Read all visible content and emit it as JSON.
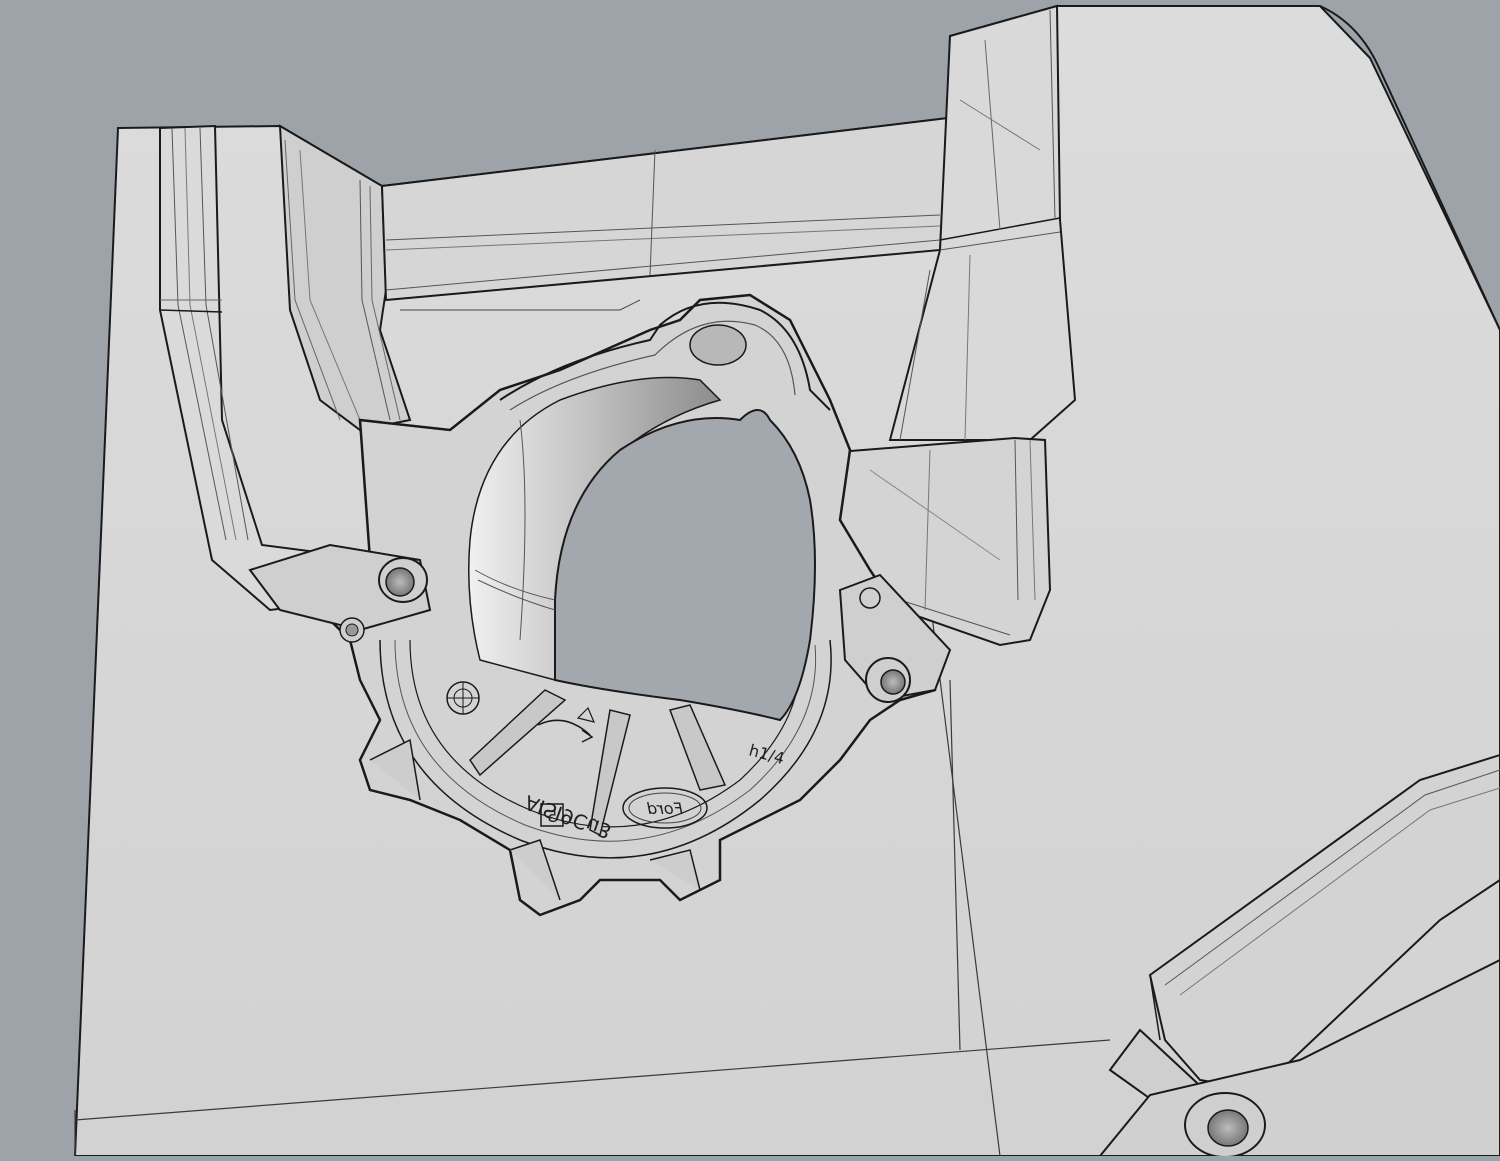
{
  "viewport": {
    "background_color": "#9ea3aa",
    "face_color": "#d8d8d8",
    "face_shadow_color": "#c7c7c7",
    "edge_color": "#1a1a1a",
    "tangent_edge_color": "#6d6d6d",
    "bore_color": "#a3a8ae"
  },
  "part": {
    "material_text": "AISI9Cu3",
    "cavity_mark": "5",
    "code_text": "h1/4",
    "logo_text": "Ford",
    "recycle_icon": "recycle-symbol-icon",
    "arrow_icon": "rotation-arrow-icon"
  }
}
